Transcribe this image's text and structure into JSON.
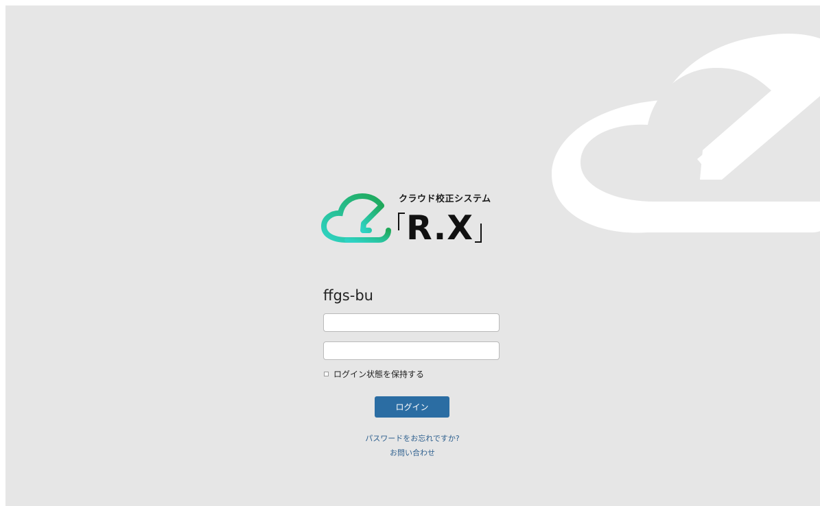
{
  "logo": {
    "subtitle": "クラウド校正システム",
    "title": "R.X"
  },
  "login": {
    "org_name": "ffgs-bu",
    "username_value": "",
    "password_value": "",
    "remember_label": "ログイン状態を保持する",
    "remember_checked": false,
    "submit_label": "ログイン"
  },
  "links": {
    "forgot_password": "パスワードをお忘れですか?",
    "contact": "お問い合わせ"
  },
  "colors": {
    "background": "#e6e6e6",
    "button": "#2b6da3",
    "link": "#2d5f8e",
    "logo_gradient_start": "#2fd3c4",
    "logo_gradient_end": "#1fa85a"
  },
  "icons": {
    "background": "cloud-check-icon",
    "logo": "cloud-check-icon"
  }
}
